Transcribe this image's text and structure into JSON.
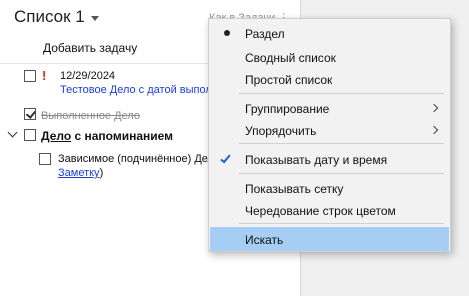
{
  "list": {
    "title": "Список 1",
    "header_link": "Как в Задачи ⋮",
    "add_task": "Добавить задачу"
  },
  "tasks": {
    "t1": {
      "priority": "!",
      "date": "12/29/2024",
      "subtitle": "Тестовое Дело с датой выполнения"
    },
    "t2": {
      "title": "Выполненное Дело"
    },
    "t3": {
      "title_underlined": "Дело",
      "title_rest": " с напоминанием"
    },
    "t4": {
      "title": "Зависимое (подчинённое) Дело",
      "note_link": "Заметку",
      "note_close": ")"
    }
  },
  "menu": {
    "items": [
      {
        "label": "Раздел",
        "mark": "bullet"
      },
      {
        "label": "Сводный список"
      },
      {
        "label": "Простой список"
      },
      {
        "label": "Группирование",
        "submenu": true
      },
      {
        "label": "Упорядочить",
        "submenu": true
      },
      {
        "label": "Показывать дату и время",
        "mark": "check"
      },
      {
        "label": "Показывать сетку"
      },
      {
        "label": "Чередование строк цветом"
      },
      {
        "label": "Искать",
        "highlighted": true
      }
    ]
  },
  "colors": {
    "accent_link": "#1a3fd6",
    "priority": "#e02020",
    "menu_highlight": "#a6cdf3",
    "check": "#1f5fc8"
  }
}
